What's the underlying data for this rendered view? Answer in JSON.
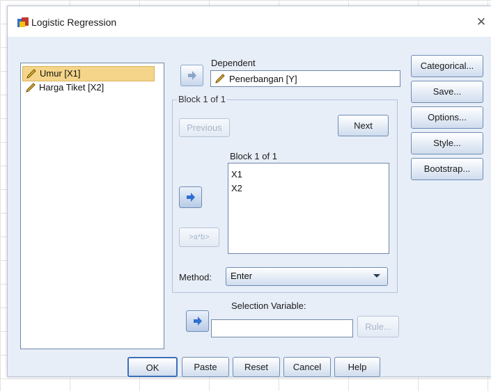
{
  "window": {
    "title": "Logistic Regression"
  },
  "source_list": [
    {
      "label": "Umur [X1]",
      "selected": true
    },
    {
      "label": "Harga Tiket [X2]",
      "selected": false
    }
  ],
  "dependent": {
    "label": "Dependent",
    "value": "Penerbangan [Y]"
  },
  "block": {
    "group_title": "Block 1 of 1",
    "list_title": "Block 1 of 1",
    "previous": "Previous",
    "next": "Next",
    "interaction": ">a*b>",
    "covariates": [
      "X1",
      "X2"
    ]
  },
  "method": {
    "label": "Method:",
    "value": "Enter"
  },
  "selection": {
    "label": "Selection Variable:",
    "value": "",
    "rule": "Rule..."
  },
  "side_buttons": [
    "Categorical...",
    "Save...",
    "Options...",
    "Style...",
    "Bootstrap..."
  ],
  "bottom_buttons": [
    "OK",
    "Paste",
    "Reset",
    "Cancel",
    "Help"
  ],
  "colors": {
    "selection": "#f4d58a",
    "dialog_bg": "#e7eef8",
    "arrow": "#2f6fd0"
  }
}
